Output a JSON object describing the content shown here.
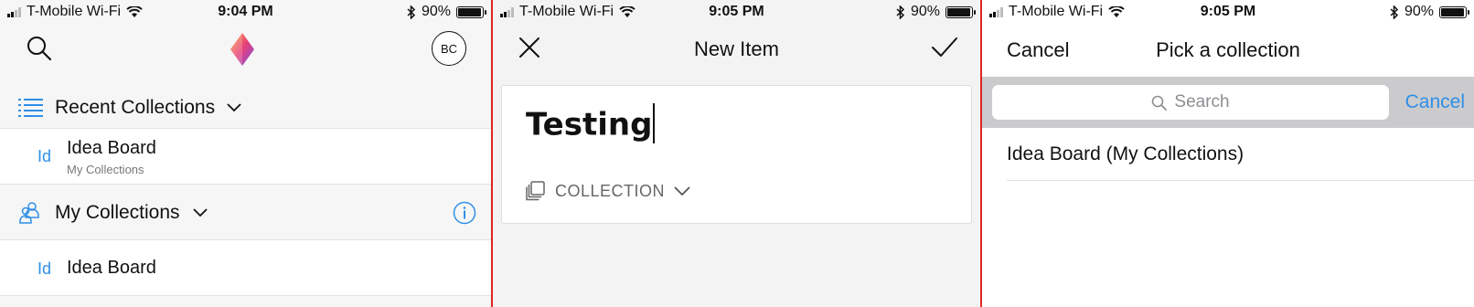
{
  "colors": {
    "accent": "#2f8fe6",
    "divider": "#e02424",
    "searchbar_bg": "#cbcbce"
  },
  "screen1": {
    "status": {
      "carrier": "T-Mobile Wi-Fi",
      "time": "9:04 PM",
      "battery": "90%"
    },
    "header": {
      "avatar_initials": "BC",
      "icons": [
        "search-icon",
        "app-logo-icon"
      ]
    },
    "recent": {
      "title": "Recent Collections",
      "items": [
        {
          "abbr": "Id",
          "title": "Idea Board",
          "subtitle": "My Collections"
        }
      ]
    },
    "my_collections": {
      "title": "My Collections",
      "items": [
        {
          "abbr": "Id",
          "title": "Idea Board"
        }
      ]
    }
  },
  "screen2": {
    "status": {
      "carrier": "T-Mobile Wi-Fi",
      "time": "9:05 PM",
      "battery": "90%"
    },
    "header": {
      "title": "New Item"
    },
    "item_title": "Testing",
    "collection_label": "COLLECTION"
  },
  "screen3": {
    "status": {
      "carrier": "T-Mobile Wi-Fi",
      "time": "9:05 PM",
      "battery": "90%"
    },
    "header": {
      "cancel": "Cancel",
      "title": "Pick a collection"
    },
    "search": {
      "placeholder": "Search",
      "cancel": "Cancel"
    },
    "items": [
      "Idea Board (My Collections)"
    ]
  }
}
